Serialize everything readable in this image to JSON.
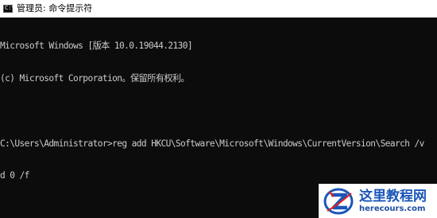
{
  "window": {
    "title": "管理员: 命令提示符",
    "icon": "cmd-icon"
  },
  "console": {
    "lines": [
      "Microsoft Windows [版本 10.0.19044.2130]",
      "(c) Microsoft Corporation。保留所有权利。",
      "",
      "C:\\Users\\Administrator>reg add HKCU\\Software\\Microsoft\\Windows\\CurrentVersion\\Search /v",
      "d 0 /f"
    ]
  },
  "watermark": {
    "name": "这里教程网",
    "url": "herecours.com",
    "logo_icon": "z-logo-icon"
  },
  "colors": {
    "console_bg": "#0c0c0c",
    "console_fg": "#cccccc",
    "titlebar_bg": "#ffffff",
    "watermark_blue": "#1a56b8",
    "logo_red": "#e02020"
  }
}
